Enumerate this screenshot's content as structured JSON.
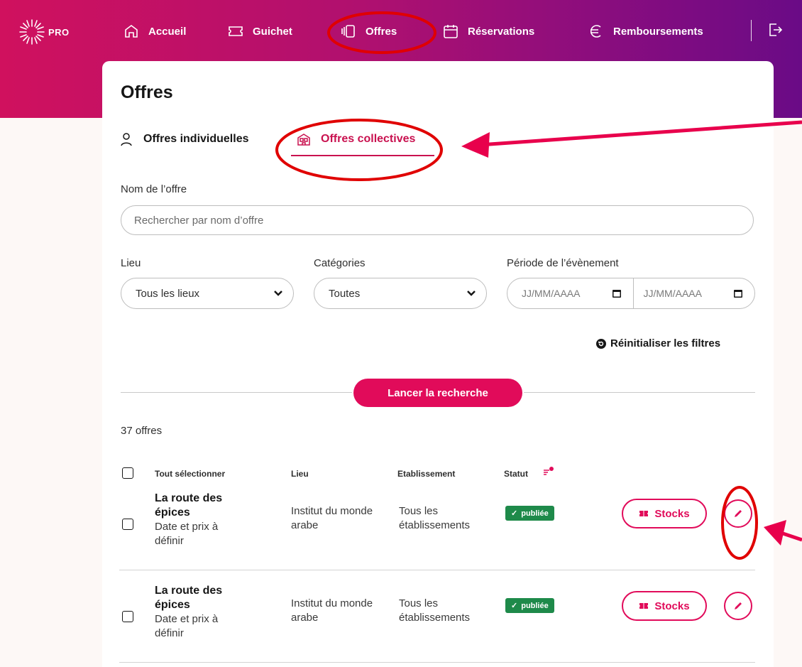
{
  "nav": {
    "logo_text": "PRO",
    "items": [
      {
        "label": "Accueil",
        "icon": "home-icon"
      },
      {
        "label": "Guichet",
        "icon": "ticket-icon"
      },
      {
        "label": "Offres",
        "icon": "offers-icon"
      },
      {
        "label": "Réservations",
        "icon": "calendar-icon"
      },
      {
        "label": "Remboursements",
        "icon": "euro-icon"
      }
    ],
    "logout_icon": "logout-icon"
  },
  "page": {
    "title": "Offres",
    "tabs": [
      {
        "label": "Offres individuelles",
        "icon": "user-icon",
        "active": false
      },
      {
        "label": "Offres collectives",
        "icon": "building-icon",
        "active": true
      }
    ]
  },
  "filters": {
    "name_label": "Nom de l’offre",
    "search_placeholder": "Rechercher par nom d’offre",
    "lieu_label": "Lieu",
    "lieu_value": "Tous les lieux",
    "categories_label": "Catégories",
    "categories_value": "Toutes",
    "period_label": "Période de l’évènement",
    "date_start_placeholder": "JJ/MM/AAAA",
    "date_end_placeholder": "JJ/MM/AAAA",
    "reset_label": "Réinitialiser les filtres",
    "search_button": "Lancer la recherche"
  },
  "results": {
    "count_label": "37 offres",
    "headers": {
      "select_all": "Tout sélectionner",
      "lieu": "Lieu",
      "etablissement": "Etablissement",
      "statut": "Statut"
    },
    "rows": [
      {
        "title": "La route des épices",
        "subtitle": "Date et prix à définir",
        "lieu": "Institut du monde arabe",
        "etablissement": "Tous les établissements",
        "status": "publiée",
        "stocks_label": "Stocks"
      },
      {
        "title": "La route des épices",
        "subtitle": "Date et prix à définir",
        "lieu": "Institut du monde arabe",
        "etablissement": "Tous les établissements",
        "status": "publiée",
        "stocks_label": "Stocks"
      }
    ]
  },
  "colors": {
    "accent": "#e10b5a",
    "tab_active": "#c9114f",
    "status_green": "#1e8a4a",
    "annotation_red": "#e00000"
  }
}
